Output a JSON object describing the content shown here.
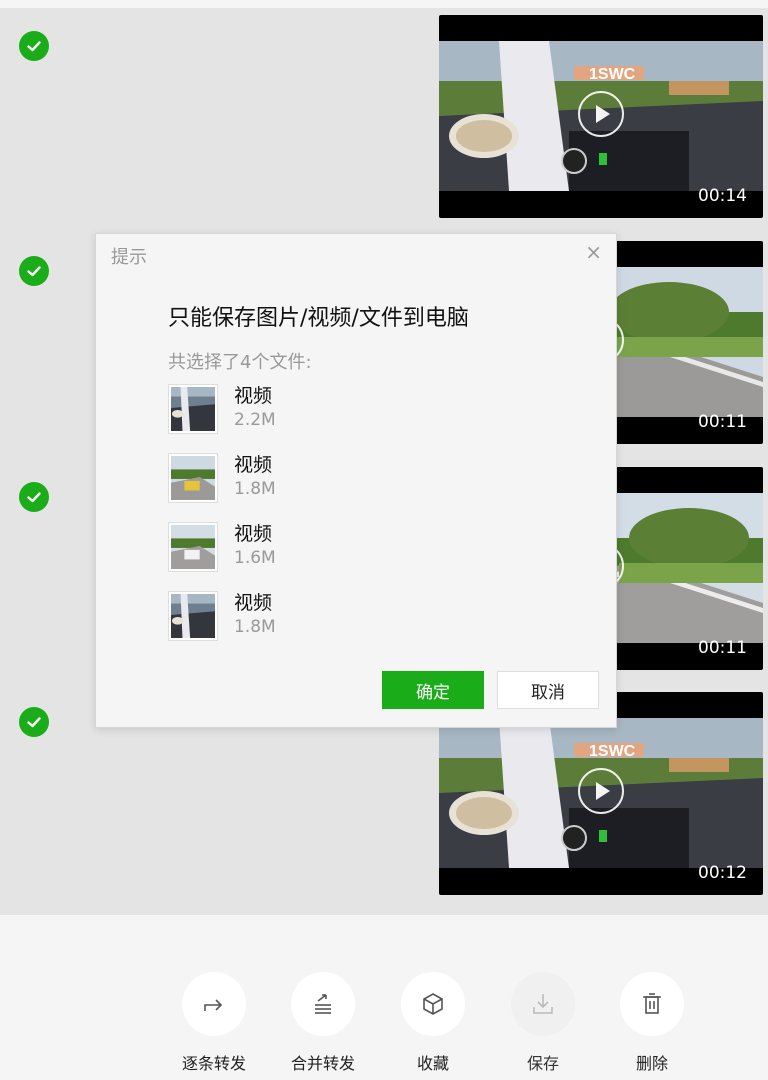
{
  "messages": [
    {
      "checked": true,
      "duration": "00:14",
      "scene": "cockpit"
    },
    {
      "checked": true,
      "duration": "00:11",
      "scene": "track"
    },
    {
      "checked": true,
      "duration": "00:11",
      "scene": "track"
    },
    {
      "checked": true,
      "duration": "00:12",
      "scene": "cockpit"
    }
  ],
  "dialog": {
    "title": "提示",
    "close_icon": "×",
    "heading": "只能保存图片/视频/文件到电脑",
    "subheading": "共选择了4个文件:",
    "files": [
      {
        "name": "视频",
        "size": "2.2M",
        "thumb": "cockpit"
      },
      {
        "name": "视频",
        "size": "1.8M",
        "thumb": "track"
      },
      {
        "name": "视频",
        "size": "1.6M",
        "thumb": "track"
      },
      {
        "name": "视频",
        "size": "1.8M",
        "thumb": "cockpit"
      }
    ],
    "confirm_label": "确定",
    "cancel_label": "取消"
  },
  "actions": {
    "forward_one_by_one": "逐条转发",
    "merge_forward": "合并转发",
    "favorite": "收藏",
    "save": "保存",
    "delete": "删除"
  },
  "colors": {
    "accent": "#1aad19",
    "chat_bg": "#e4e4e4",
    "bar_bg": "#f5f5f5"
  }
}
